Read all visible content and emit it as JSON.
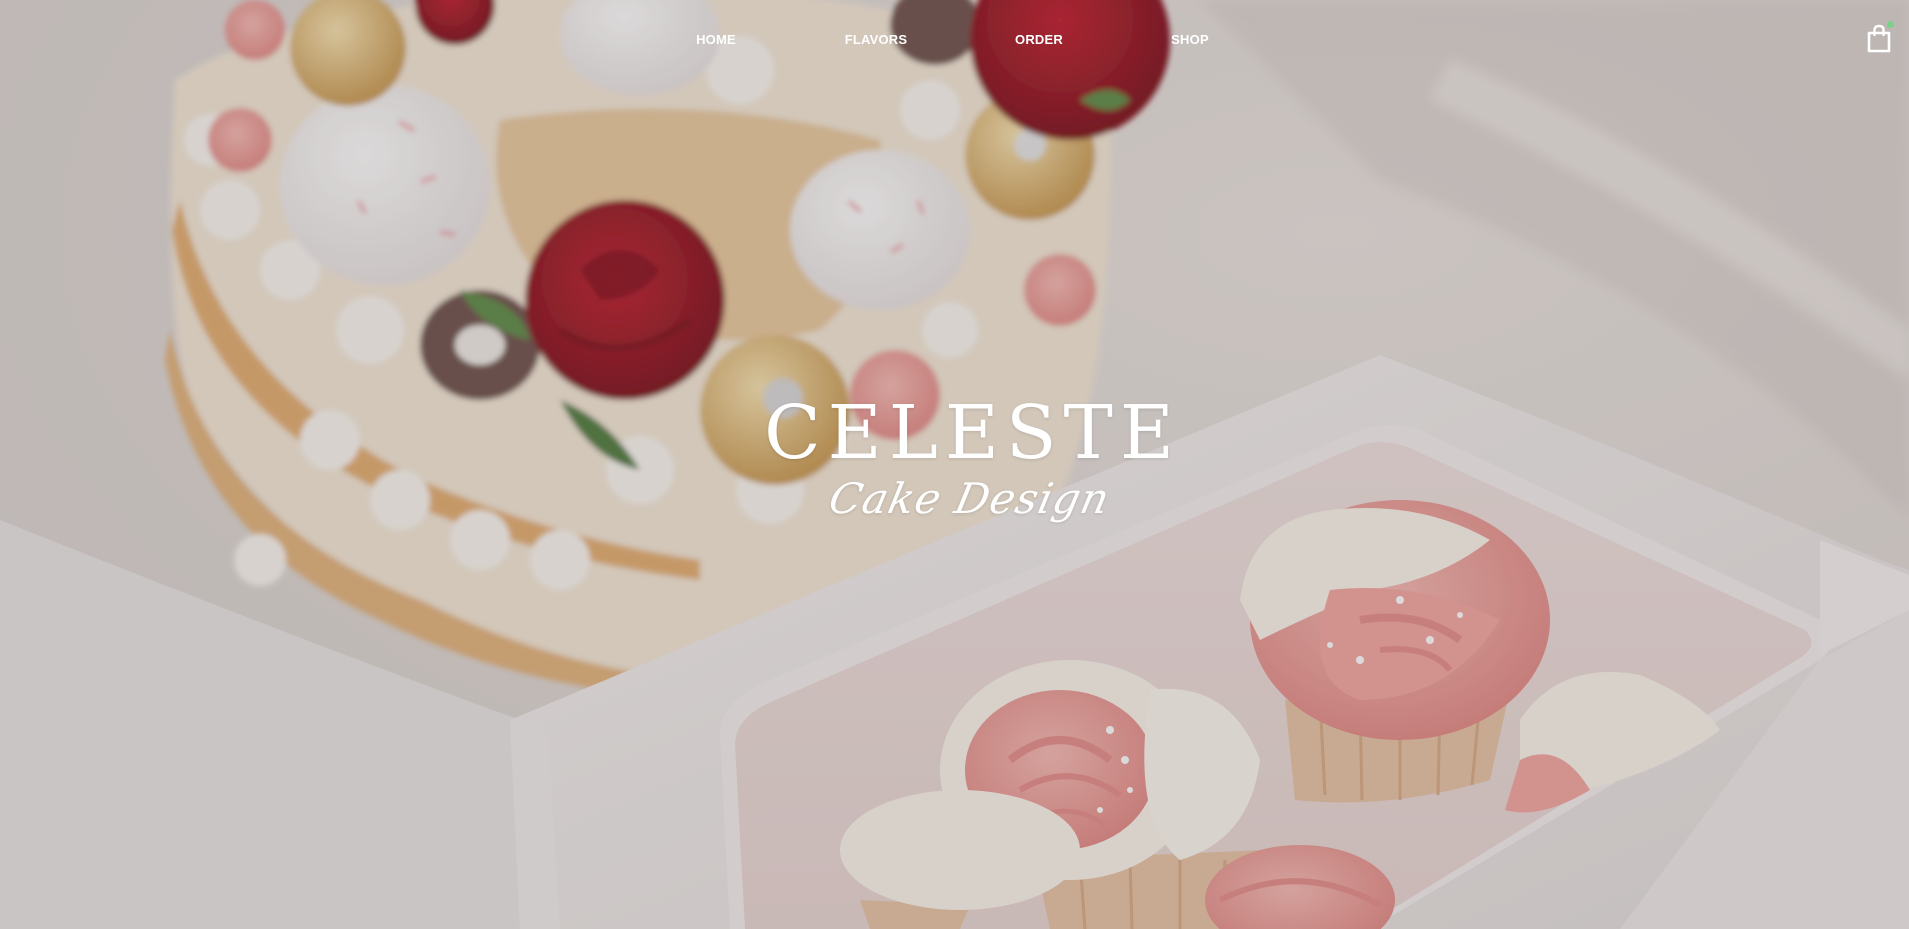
{
  "nav": {
    "items": [
      {
        "label": "HOME"
      },
      {
        "label": "FLAVORS"
      },
      {
        "label": "ORDER"
      },
      {
        "label": "SHOP"
      }
    ],
    "cart_icon": "shopping-bag-icon",
    "cart_badge_color": "#7ad18a"
  },
  "hero": {
    "brand_name": "CELESTE",
    "brand_tagline": "Cake Design"
  },
  "colors": {
    "text": "#ffffff",
    "overlay": "#5a5050"
  }
}
